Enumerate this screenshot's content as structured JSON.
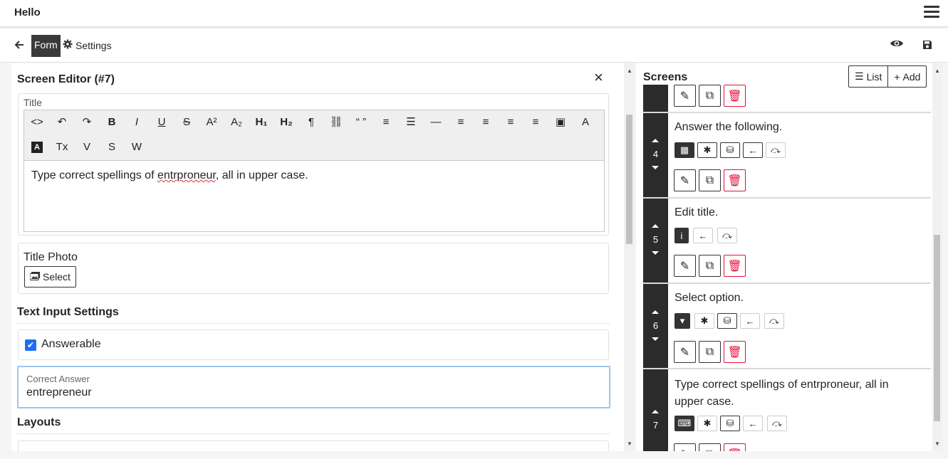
{
  "app": {
    "title": "Hello"
  },
  "nav": {
    "form_label": "Form",
    "settings_label": "Settings"
  },
  "editor": {
    "title": "Screen Editor (#7)",
    "title_field_label": "Title",
    "title_content_before": "Type correct spellings of ",
    "title_content_misspelled": "entrproneur",
    "title_content_after": ", all in upper case.",
    "toolbar_row1": [
      "<>",
      "↶",
      "↷",
      "B",
      "I",
      "U",
      "S",
      "A²",
      "A₂",
      "H₁",
      "H₂",
      "¶",
      "⛓",
      "“ ”",
      "≡",
      "☰",
      "—",
      "≡",
      "≡",
      "≡",
      "≡",
      "▣",
      "A"
    ],
    "toolbar_row2": [
      "A",
      "Tx",
      "V",
      "S",
      "W"
    ],
    "title_photo_label": "Title Photo",
    "select_label": "Select",
    "text_input_settings_heading": "Text Input Settings",
    "answerable_label": "Answerable",
    "answerable_checked": true,
    "correct_answer_label": "Correct Answer",
    "correct_answer_value": "entrepreneur",
    "layouts_heading": "Layouts"
  },
  "screens": {
    "title": "Screens",
    "list_label": "List",
    "add_label": "Add",
    "items": [
      {
        "number": "4",
        "title": "Answer the following."
      },
      {
        "number": "5",
        "title": "Edit title."
      },
      {
        "number": "6",
        "title": "Select option."
      },
      {
        "number": "7",
        "title": "Type correct spellings of entrproneur, all in upper case."
      }
    ]
  },
  "colors": {
    "accent": "#1d6ff1",
    "danger": "#dc143c",
    "dark": "#2b2b2b"
  }
}
